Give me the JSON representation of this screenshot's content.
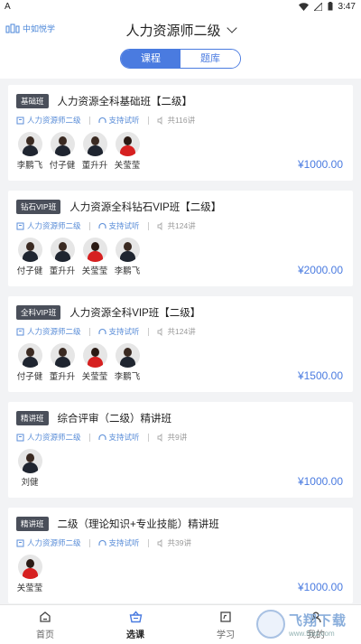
{
  "statusbar": {
    "left": "A",
    "time": "3:47"
  },
  "header": {
    "brand": "中如悦学",
    "title": "人力资源师二级"
  },
  "segment": {
    "tabs": [
      "课程",
      "题库"
    ]
  },
  "courses": [
    {
      "badge": "基础班",
      "title": "人力资源全科基础班【二级】",
      "category": "人力资源师二级",
      "trial": "支持试听",
      "lessons": "共116讲",
      "teachers": [
        {
          "name": "李鹏飞",
          "style": "dark"
        },
        {
          "name": "付子健",
          "style": "dark"
        },
        {
          "name": "董升升",
          "style": "dark"
        },
        {
          "name": "关莹莹",
          "style": "red"
        }
      ],
      "price": "¥1000.00"
    },
    {
      "badge": "钻石VIP班",
      "title": "人力资源全科钻石VIP班【二级】",
      "category": "人力资源师二级",
      "trial": "支持试听",
      "lessons": "共124讲",
      "teachers": [
        {
          "name": "付子健",
          "style": "dark"
        },
        {
          "name": "董升升",
          "style": "dark"
        },
        {
          "name": "关莹莹",
          "style": "red"
        },
        {
          "name": "李鹏飞",
          "style": "dark"
        }
      ],
      "price": "¥2000.00"
    },
    {
      "badge": "全科VIP班",
      "title": "人力资源全科VIP班【二级】",
      "category": "人力资源师二级",
      "trial": "支持试听",
      "lessons": "共124讲",
      "teachers": [
        {
          "name": "付子健",
          "style": "dark"
        },
        {
          "name": "董升升",
          "style": "dark"
        },
        {
          "name": "关莹莹",
          "style": "red"
        },
        {
          "name": "李鹏飞",
          "style": "dark"
        }
      ],
      "price": "¥1500.00"
    },
    {
      "badge": "精讲班",
      "title": "综合评审（二级）精讲班",
      "category": "人力资源师二级",
      "trial": "支持试听",
      "lessons": "共9讲",
      "teachers": [
        {
          "name": "刘健",
          "style": "dark"
        }
      ],
      "price": "¥1000.00"
    },
    {
      "badge": "精讲班",
      "title": "二级（理论知识+专业技能）精讲班",
      "category": "人力资源师二级",
      "trial": "支持试听",
      "lessons": "共39讲",
      "teachers": [
        {
          "name": "关莹莹",
          "style": "red"
        }
      ],
      "price": "¥1000.00"
    }
  ],
  "tabbar": [
    {
      "label": "首页",
      "icon": "home-icon"
    },
    {
      "label": "选课",
      "icon": "basket-icon"
    },
    {
      "label": "学习",
      "icon": "study-icon"
    },
    {
      "label": "我的",
      "icon": "profile-icon"
    }
  ],
  "watermark": {
    "big": "飞翔下载",
    "small": "www.fxxz.com"
  },
  "colors": {
    "accent": "#4a7be0",
    "badge": "#4a4f5a"
  }
}
